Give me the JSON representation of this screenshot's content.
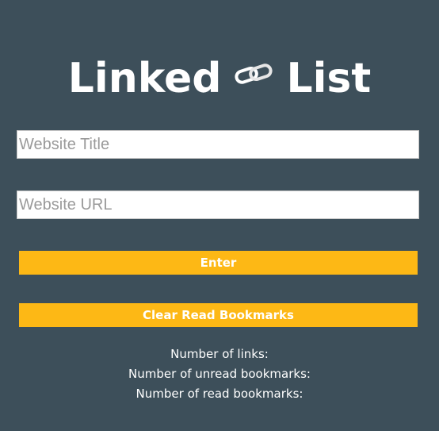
{
  "header": {
    "title_left": "Linked",
    "title_right": "List",
    "logo_icon": "chain-link-icon"
  },
  "form": {
    "title_placeholder": "Website Title",
    "url_placeholder": "Website URL",
    "title_value": "",
    "url_value": ""
  },
  "buttons": {
    "enter_label": "Enter",
    "clear_label": "Clear Read Bookmarks"
  },
  "stats": {
    "links_label": "Number of links:",
    "unread_label": "Number of unread bookmarks:",
    "read_label": "Number of read bookmarks:"
  },
  "colors": {
    "background": "#3d4f5a",
    "accent": "#fdb815",
    "text": "#ffffff"
  }
}
